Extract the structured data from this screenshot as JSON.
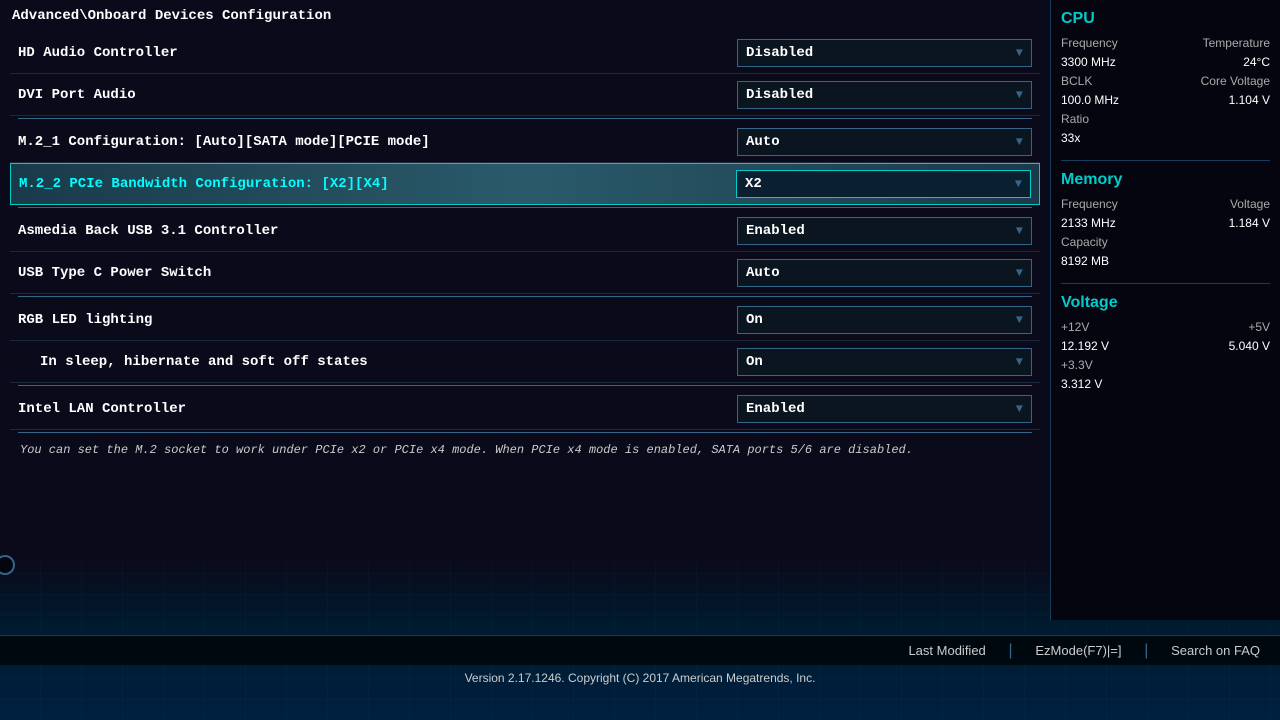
{
  "breadcrumb": "Advanced\\Onboard Devices Configuration",
  "settings": [
    {
      "label": "HD Audio Controller",
      "value": "Disabled",
      "highlighted": false,
      "subItem": false,
      "id": "hd-audio"
    },
    {
      "label": "DVI Port Audio",
      "value": "Disabled",
      "highlighted": false,
      "subItem": false,
      "id": "dvi-audio"
    },
    {
      "label": "M.2_1 Configuration: [Auto][SATA mode][PCIE mode]",
      "value": "Auto",
      "highlighted": false,
      "subItem": false,
      "id": "m2-1-config"
    },
    {
      "label": "M.2_2 PCIe Bandwidth Configuration: [X2][X4]",
      "value": "X2",
      "highlighted": true,
      "subItem": false,
      "id": "m2-2-pcie"
    },
    {
      "label": "Asmedia Back USB 3.1 Controller",
      "value": "Enabled",
      "highlighted": false,
      "subItem": false,
      "id": "asmedia-usb"
    },
    {
      "label": "USB Type C Power Switch",
      "value": "Auto",
      "highlighted": false,
      "subItem": false,
      "id": "usb-type-c"
    },
    {
      "label": "RGB LED lighting",
      "value": "On",
      "highlighted": false,
      "subItem": false,
      "id": "rgb-led"
    },
    {
      "label": "In sleep, hibernate and soft off states",
      "value": "On",
      "highlighted": false,
      "subItem": true,
      "id": "sleep-rgb"
    },
    {
      "label": "Intel LAN Controller",
      "value": "Enabled",
      "highlighted": false,
      "subItem": false,
      "id": "intel-lan"
    }
  ],
  "info_text": "You can set the M.2 socket to work under PCIe x2 or PCIe x4 mode. When PCIe x4 mode is enabled, SATA ports 5/6 are disabled.",
  "cpu": {
    "title": "CPU",
    "frequency_label": "Frequency",
    "frequency_value": "3300 MHz",
    "temperature_label": "Temperature",
    "temperature_value": "24°C",
    "bclk_label": "BCLK",
    "bclk_value": "100.0 MHz",
    "core_voltage_label": "Core Voltage",
    "core_voltage_value": "1.104 V",
    "ratio_label": "Ratio",
    "ratio_value": "33x"
  },
  "memory": {
    "title": "Memory",
    "frequency_label": "Frequency",
    "frequency_value": "2133 MHz",
    "voltage_label": "Voltage",
    "voltage_value": "1.184 V",
    "capacity_label": "Capacity",
    "capacity_value": "8192 MB"
  },
  "voltage": {
    "title": "Voltage",
    "v12_label": "+12V",
    "v12_value": "12.192 V",
    "v5_label": "+5V",
    "v5_value": "5.040 V",
    "v33_label": "+3.3V",
    "v33_value": "3.312 V"
  },
  "bottom": {
    "last_modified": "Last Modified",
    "ezmode": "EzMode(F7)|=]",
    "search_faq": "Search on FAQ"
  },
  "copyright": "Version 2.17.1246. Copyright (C) 2017 American Megatrends, Inc."
}
